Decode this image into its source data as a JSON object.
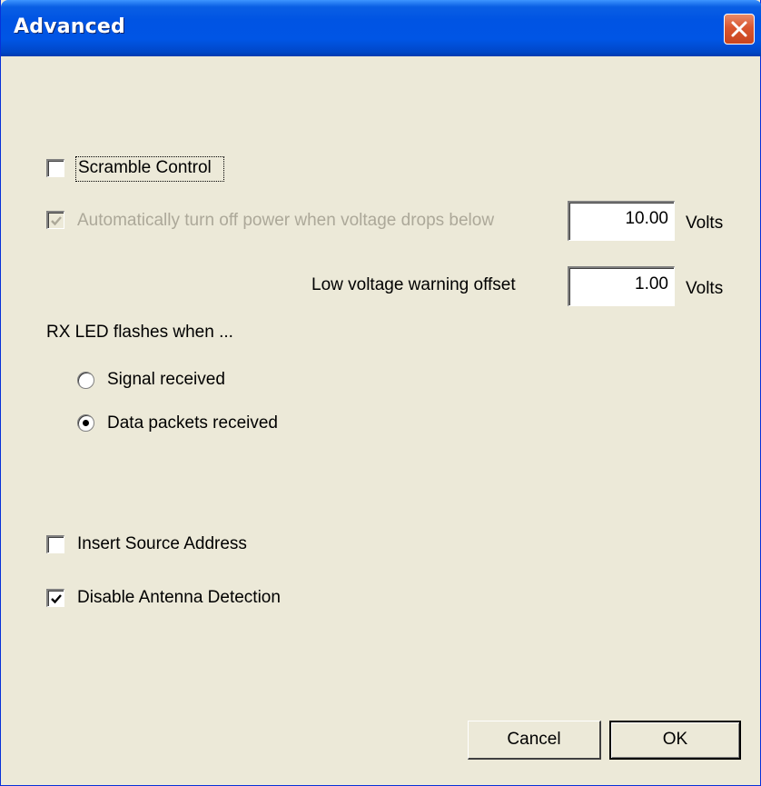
{
  "window": {
    "title": "Advanced",
    "close_icon": "close-icon"
  },
  "scramble": {
    "label": "Scramble Control",
    "checked": false
  },
  "auto_off": {
    "label": "Automatically turn off power when voltage drops below",
    "checked": true,
    "enabled": false,
    "value": "10.00",
    "unit": "Volts"
  },
  "low_voltage": {
    "label": "Low voltage warning offset",
    "value": "1.00",
    "unit": "Volts"
  },
  "rx_led": {
    "heading": "RX LED flashes when ...",
    "options": [
      {
        "label": "Signal received",
        "selected": false
      },
      {
        "label": "Data packets received",
        "selected": true
      }
    ]
  },
  "insert_source": {
    "label": "Insert Source Address",
    "checked": false
  },
  "disable_antenna": {
    "label": "Disable Antenna Detection",
    "checked": true
  },
  "buttons": {
    "cancel": "Cancel",
    "ok": "OK"
  },
  "colors": {
    "title_bar": "#0054e3",
    "face": "#ece9d8",
    "close": "#d9562f",
    "disabled_text": "#aca899"
  }
}
